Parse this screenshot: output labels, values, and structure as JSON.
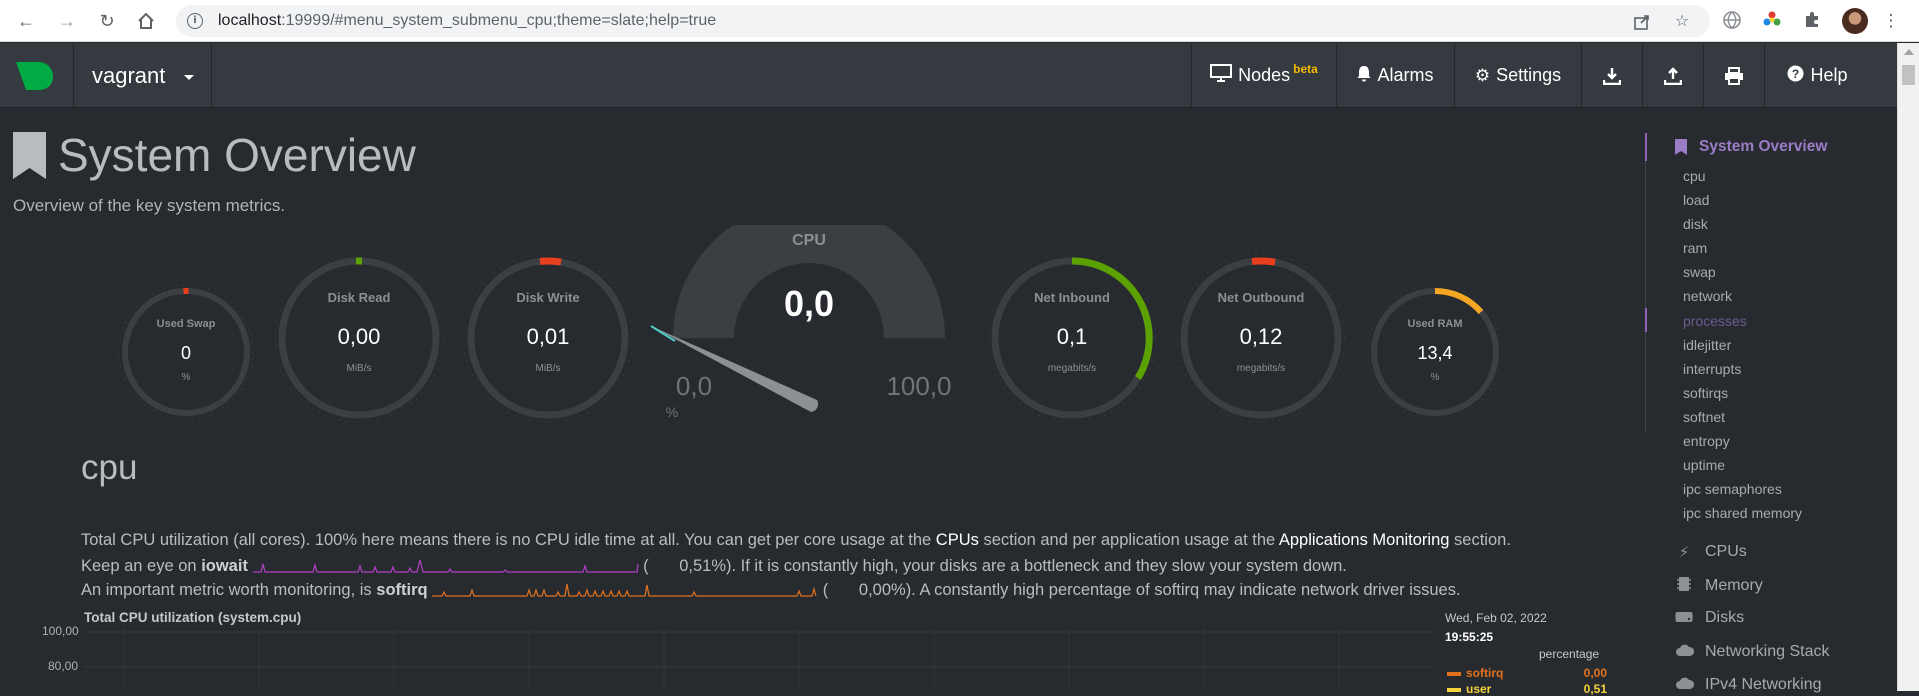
{
  "browser": {
    "url_host": "localhost",
    "url_rest": ":19999/#menu_system_submenu_cpu;theme=slate;help=true"
  },
  "topbar": {
    "host": "vagrant",
    "nodes_label": "Nodes",
    "nodes_badge": "beta",
    "alarms_label": "Alarms",
    "settings_label": "Settings",
    "help_label": "Help"
  },
  "page": {
    "title": "System Overview",
    "subtitle": "Overview of the key system metrics."
  },
  "gauges": {
    "used_swap": {
      "title": "Used Swap",
      "value": "0",
      "unit": "%",
      "fraction": 0.01
    },
    "disk_read": {
      "title": "Disk Read",
      "value": "0,00",
      "unit": "MiB/s",
      "fraction": 0.01
    },
    "disk_write": {
      "title": "Disk Write",
      "value": "0,01",
      "unit": "MiB/s",
      "fraction": 0.02
    },
    "cpu": {
      "title": "CPU",
      "value": "0,0",
      "min": "0,0",
      "max": "100,0",
      "unit": "%",
      "fraction": 0.02
    },
    "net_inbound": {
      "title": "Net Inbound",
      "value": "0,1",
      "unit": "megabits/s",
      "fraction": 0.34
    },
    "net_outbound": {
      "title": "Net Outbound",
      "value": "0,12",
      "unit": "megabits/s",
      "fraction": 0.02
    },
    "used_ram": {
      "title": "Used RAM",
      "value": "13,4",
      "unit": "%",
      "fraction": 0.134
    }
  },
  "section": {
    "title": "cpu",
    "line1_a": "Total CPU utilization (all cores). 100% here means there is no CPU idle time at all. You can get per core usage at the ",
    "line1_link1": "CPUs",
    "line1_b": " section and per application usage at the ",
    "line1_link2": "Applications Monitoring",
    "line1_c": " section.",
    "line2_a": "Keep an eye on ",
    "line2_metric": "iowait",
    "line2_value": "0,51%",
    "line2_b": "). If it is constantly high, your disks are a bottleneck and they slow your system down.",
    "line3_a": "An important metric worth monitoring, is ",
    "line3_metric": "softirq",
    "line3_value": "0,00%",
    "line3_b": "). A constantly high percentage of softirq may indicate network driver issues."
  },
  "chart": {
    "title": "Total CPU utilization (system.cpu)",
    "y_ticks": [
      "100,00",
      "80,00"
    ],
    "date": "Wed, Feb 02, 2022",
    "time": "19:55:25",
    "unit": "percentage",
    "legend": [
      {
        "name": "softirq",
        "value": "0,00",
        "color": "#e2711d"
      },
      {
        "name": "user",
        "value": "0,51",
        "color": "#f5d33a"
      }
    ]
  },
  "sidebar": {
    "heading": "System Overview",
    "items": [
      "cpu",
      "load",
      "disk",
      "ram",
      "swap",
      "network",
      "processes",
      "idlejitter",
      "interrupts",
      "softirqs",
      "softnet",
      "entropy",
      "uptime",
      "ipc semaphores",
      "ipc shared memory"
    ],
    "groups": [
      "CPUs",
      "Memory",
      "Disks",
      "Networking Stack",
      "IPv4 Networking"
    ]
  },
  "colors": {
    "accent_purple": "#9b7cc7",
    "logo_green": "#00ab44",
    "gauge_green": "#5ba100",
    "gauge_red": "#e8401d",
    "gauge_orange": "#f5a623"
  }
}
